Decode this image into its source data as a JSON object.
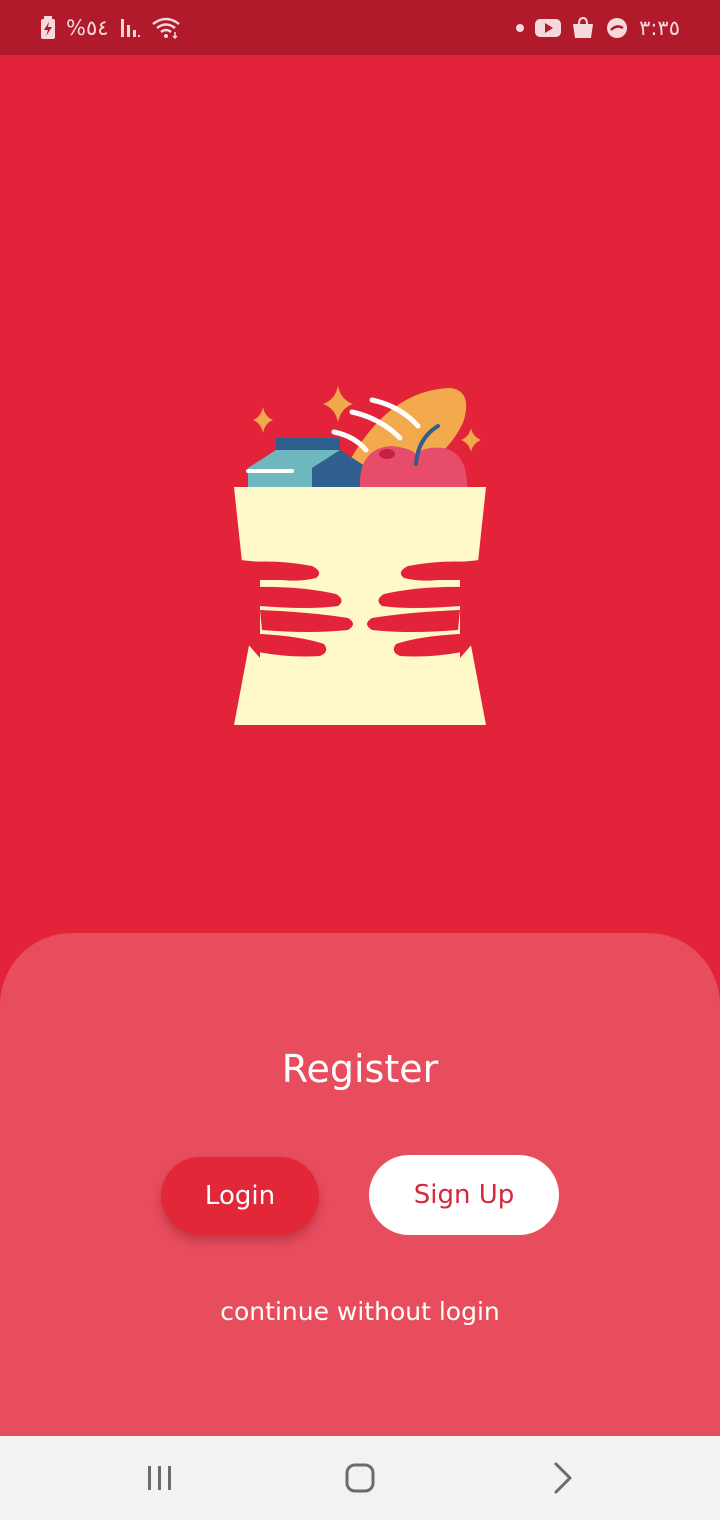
{
  "status_bar": {
    "battery_text": "%٥٤",
    "time": "٣:٣٥",
    "icons": [
      "battery-icon",
      "signal-icon",
      "wifi-icon",
      "dot-icon",
      "youtube-icon",
      "shopping-bag-icon",
      "app-icon"
    ]
  },
  "hero": {
    "illustration": "grocery-bag-illustration"
  },
  "sheet": {
    "title": "Register",
    "login_label": "Login",
    "signup_label": "Sign Up",
    "continue_label": "continue without login"
  },
  "nav_bar": {
    "icons": [
      "recent-apps-icon",
      "home-icon",
      "back-icon"
    ]
  },
  "colors": {
    "background": "#e32339",
    "status_bar": "#b01a2b",
    "sheet": "#e84d5e",
    "login_button": "#e22739",
    "signup_button": "#ffffff",
    "signup_text": "#d9263a",
    "nav_bar": "#f2f2f2"
  }
}
